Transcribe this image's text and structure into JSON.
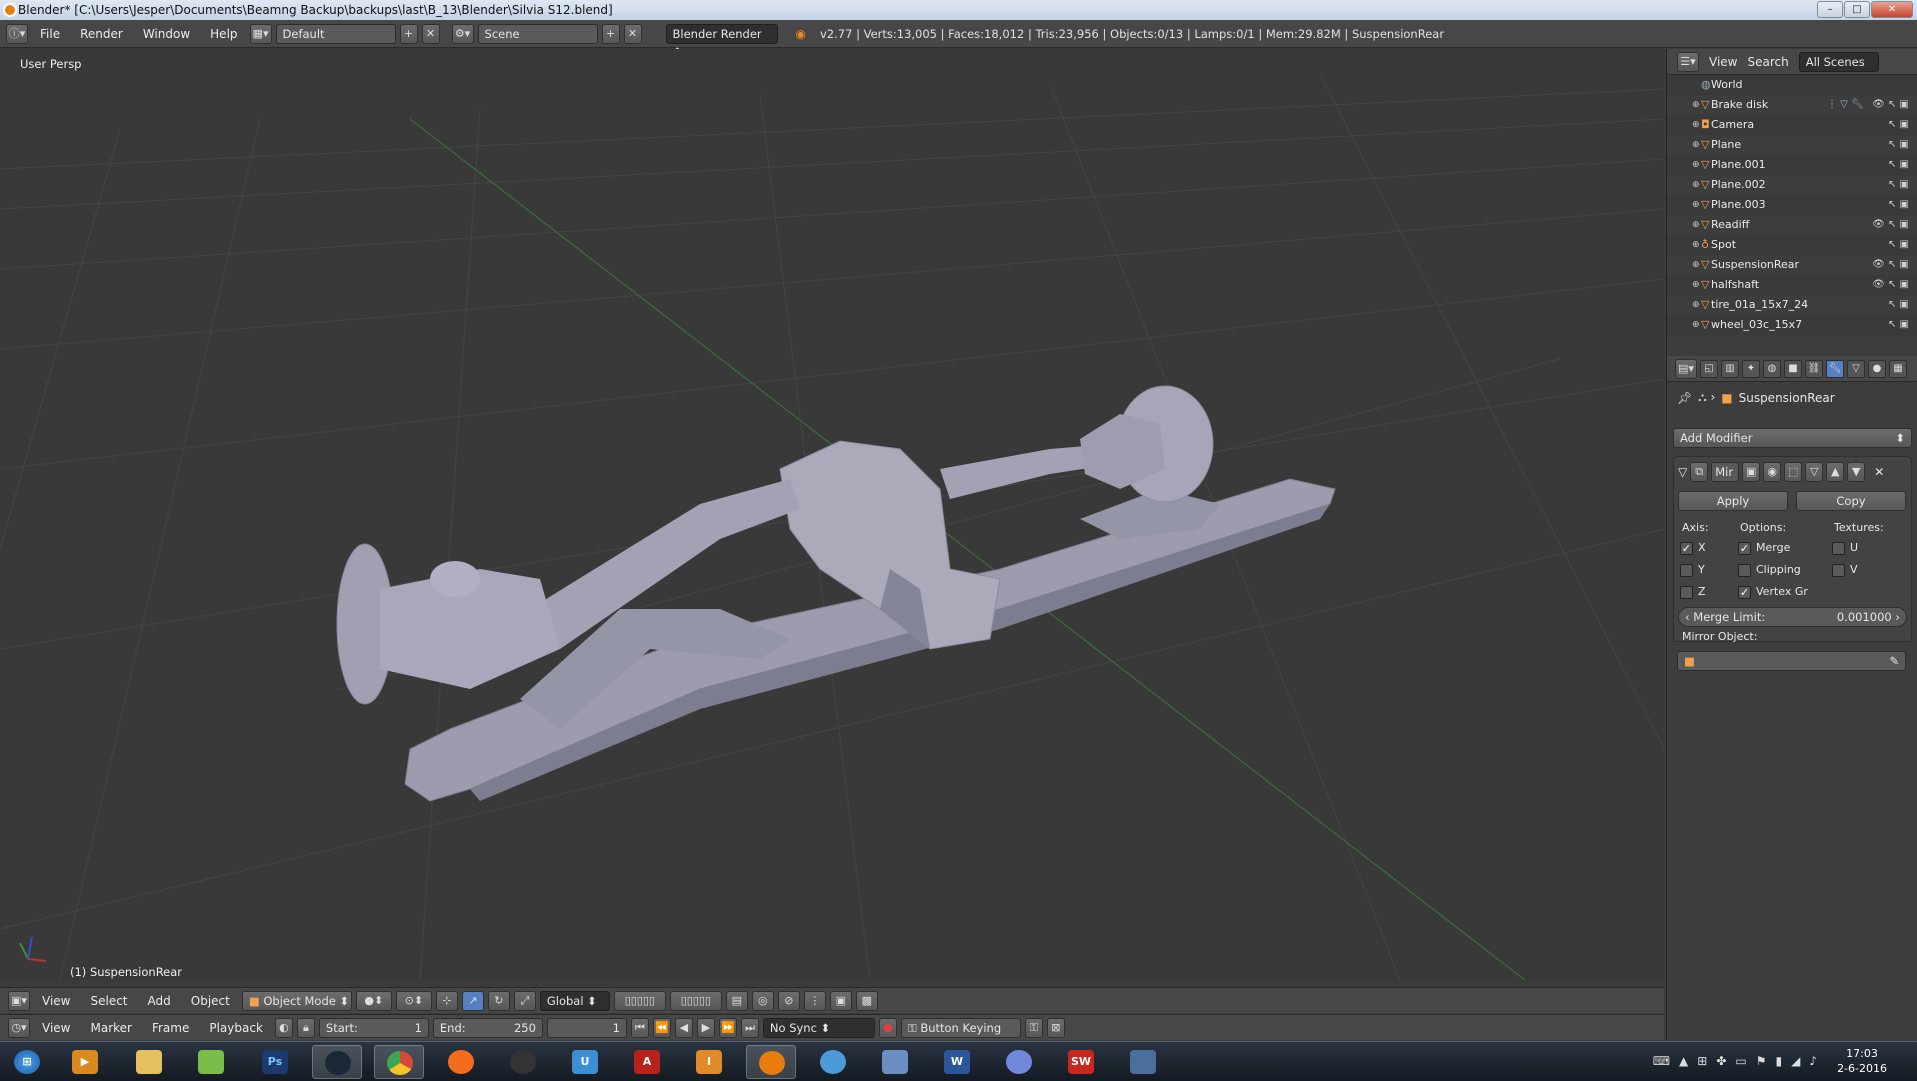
{
  "window": {
    "title": "Blender* [C:\\Users\\Jesper\\Documents\\Beamng Backup\\backups\\last\\B_13\\Blender\\Silvia S12.blend]",
    "controls": [
      "–",
      "□",
      "✕"
    ]
  },
  "info_header": {
    "menus": [
      "File",
      "Render",
      "Window",
      "Help"
    ],
    "screen_layout": "Default",
    "scene": "Scene",
    "render_engine": "Blender Render",
    "stats": "v2.77 | Verts:13,005 | Faces:18,012 | Tris:23,956 | Objects:0/13 | Lamps:0/1 | Mem:29.82M | SuspensionRear"
  },
  "viewport": {
    "view_label": "User Persp",
    "active_object_label": "(1) SuspensionRear"
  },
  "viewport_header": {
    "menus": [
      "View",
      "Select",
      "Add",
      "Object"
    ],
    "mode": "Object Mode",
    "orientation": "Global"
  },
  "timeline": {
    "menus": [
      "View",
      "Marker",
      "Frame",
      "Playback"
    ],
    "start_label": "Start:",
    "start": "1",
    "end_label": "End:",
    "end": "250",
    "current": "1",
    "sync": "No Sync",
    "keying": "Button Keying ..."
  },
  "outliner": {
    "menus": [
      "View",
      "Search"
    ],
    "filter": "All Scenes",
    "items": [
      {
        "name": "World",
        "icon": "world-icon"
      },
      {
        "name": "Brake disk",
        "icon": "mesh-icon"
      },
      {
        "name": "Camera",
        "icon": "camera-icon"
      },
      {
        "name": "Plane",
        "icon": "mesh-icon"
      },
      {
        "name": "Plane.001",
        "icon": "mesh-icon"
      },
      {
        "name": "Plane.002",
        "icon": "mesh-icon"
      },
      {
        "name": "Plane.003",
        "icon": "mesh-icon"
      },
      {
        "name": "Readiff",
        "icon": "mesh-icon"
      },
      {
        "name": "Spot",
        "icon": "lamp-icon"
      },
      {
        "name": "SuspensionRear",
        "icon": "mesh-icon"
      },
      {
        "name": "halfshaft",
        "icon": "mesh-icon"
      },
      {
        "name": "tire_01a_15x7_24",
        "icon": "mesh-icon"
      },
      {
        "name": "wheel_03c_15x7",
        "icon": "mesh-icon"
      }
    ]
  },
  "properties": {
    "context_object": "SuspensionRear",
    "add_modifier": "Add Modifier",
    "modifier_name": "Mir",
    "apply": "Apply",
    "copy": "Copy",
    "axis_label": "Axis:",
    "options_label": "Options:",
    "textures_label": "Textures:",
    "axis": [
      {
        "label": "X",
        "checked": true
      },
      {
        "label": "Y",
        "checked": false
      },
      {
        "label": "Z",
        "checked": false
      }
    ],
    "options": [
      {
        "label": "Merge",
        "checked": true
      },
      {
        "label": "Clipping",
        "checked": false
      },
      {
        "label": "Vertex Gr",
        "checked": true
      }
    ],
    "textures": [
      {
        "label": "U",
        "checked": false
      },
      {
        "label": "V",
        "checked": false
      }
    ],
    "merge_limit_label": "Merge Limit:",
    "merge_limit": "0.001000",
    "mirror_object_label": "Mirror Object:"
  },
  "taskbar": {
    "time": "17:03",
    "date": "2-6-2016",
    "apps": [
      {
        "name": "start-button",
        "label": "",
        "color": "#2f78c8"
      },
      {
        "name": "media-player-app",
        "label": "▶",
        "color": "#d98a1f"
      },
      {
        "name": "file-explorer-app",
        "label": "",
        "color": "#e6c060"
      },
      {
        "name": "notepad-plus-app",
        "label": "",
        "color": "#7bbd4a"
      },
      {
        "name": "photoshop-app",
        "label": "Ps",
        "color": "#1d3a6e"
      },
      {
        "name": "steam-app",
        "label": "",
        "color": "#1b2838"
      },
      {
        "name": "chrome-app",
        "label": "",
        "color": "#d44a36"
      },
      {
        "name": "origin-app",
        "label": "",
        "color": "#f56c1c"
      },
      {
        "name": "obs-app",
        "label": "",
        "color": "#333"
      },
      {
        "name": "uplay-app",
        "label": "U",
        "color": "#3c8fd1"
      },
      {
        "name": "autocad-app",
        "label": "A",
        "color": "#b8221d"
      },
      {
        "name": "inventor-app",
        "label": "I",
        "color": "#e08a2a"
      },
      {
        "name": "blender-app",
        "label": "",
        "color": "#e87d0d"
      },
      {
        "name": "eye-app",
        "label": "",
        "color": "#4a9bd6"
      },
      {
        "name": "paint-app",
        "label": "",
        "color": "#6a8fc0"
      },
      {
        "name": "word-app",
        "label": "W",
        "color": "#2b579a"
      },
      {
        "name": "discord-app",
        "label": "",
        "color": "#7289da"
      },
      {
        "name": "solidworks-app",
        "label": "SW",
        "color": "#c9261e"
      },
      {
        "name": "window-app",
        "label": "",
        "color": "#4a6f9a"
      }
    ]
  }
}
